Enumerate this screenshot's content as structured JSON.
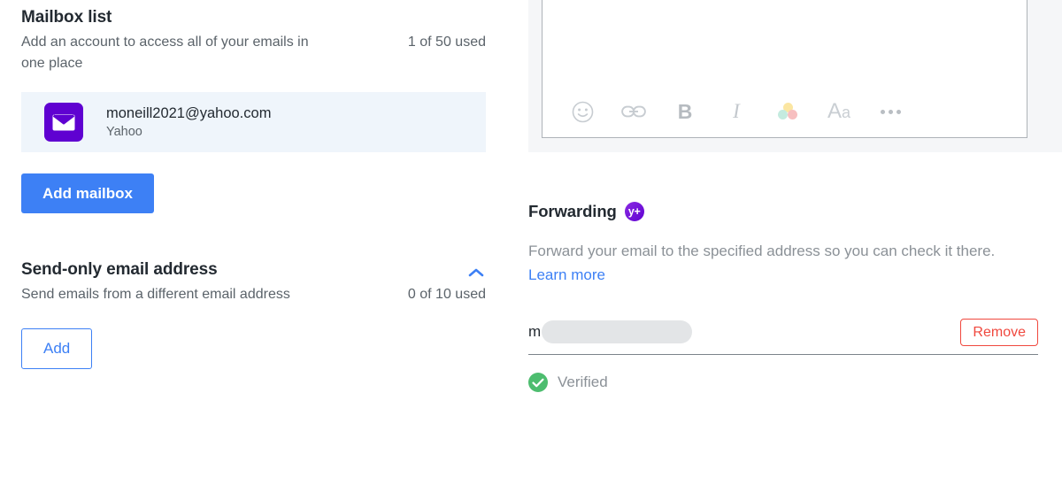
{
  "left_panel": {
    "mailbox_section": {
      "title": "Mailbox list",
      "description": "Add an account to access all of your emails in one place",
      "usage": "1 of 50 used",
      "accounts": [
        {
          "email": "moneill2021@yahoo.com",
          "provider": "Yahoo",
          "icon": "envelope-icon"
        }
      ],
      "add_button_label": "Add mailbox"
    },
    "send_only_section": {
      "title": "Send-only email address",
      "description": "Send emails from a different email address",
      "usage": "0 of 10 used",
      "collapse_icon": "chevron-up-icon",
      "add_button_label": "Add"
    }
  },
  "right_panel": {
    "compose": {
      "toolbar": [
        {
          "name": "emoji-icon",
          "label": ""
        },
        {
          "name": "link-icon",
          "label": ""
        },
        {
          "name": "bold-icon",
          "label": "B"
        },
        {
          "name": "italic-icon",
          "label": "I"
        },
        {
          "name": "text-color-icon",
          "label": ""
        },
        {
          "name": "font-size-icon",
          "label": "Aa"
        },
        {
          "name": "more-options-icon",
          "label": ""
        }
      ],
      "font_size_big": "A",
      "font_size_small": "a"
    },
    "forwarding": {
      "title": "Forwarding",
      "plus_badge": "y+",
      "description_before_link": "Forward your email to the specified address so you can check it there.",
      "learn_more_label": "Learn more",
      "address_visible_prefix": "m",
      "address_redacted": true,
      "remove_button_label": "Remove",
      "status_label": "Verified",
      "status_icon": "check-circle-icon"
    }
  },
  "colors": {
    "accent_blue": "#3d80f5",
    "yahoo_purple": "#5f01d1",
    "danger_red": "#f0483e",
    "success_green": "#4dbd6f",
    "card_background": "#eff5fb",
    "muted_text": "#5b636a"
  }
}
